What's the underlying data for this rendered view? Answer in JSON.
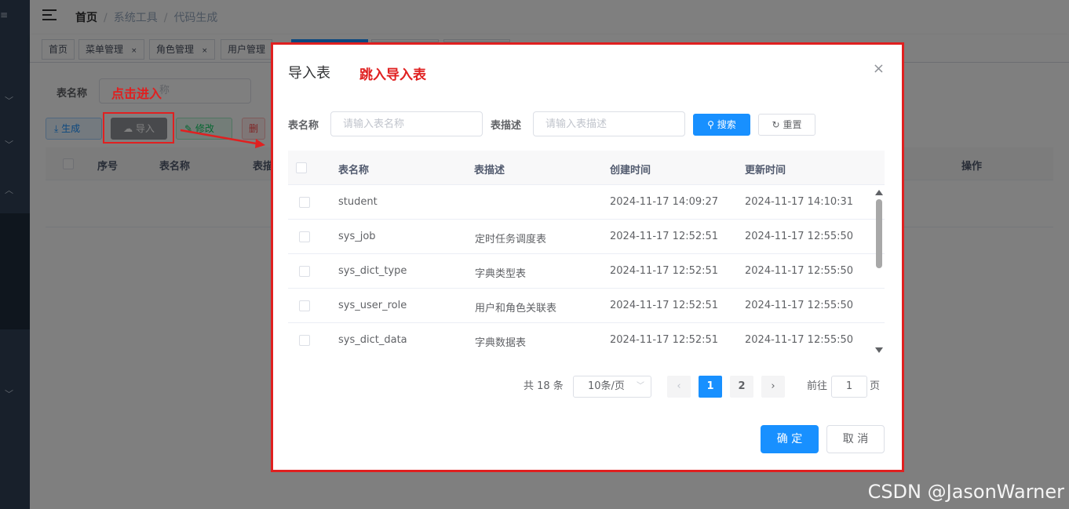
{
  "sidebar": {
    "top_glyph": "≡"
  },
  "navbar": {
    "breadcrumb": [
      "首页",
      "系统工具",
      "代码生成"
    ]
  },
  "tags": [
    {
      "label": "首页"
    },
    {
      "label": "菜单管理",
      "close": "×"
    },
    {
      "label": "角色管理",
      "close": "×"
    },
    {
      "label": "用户管理"
    }
  ],
  "background": {
    "filter_label": "表名称",
    "filter_placeholder": "称",
    "buttons": {
      "generate": "生成",
      "import": "导入",
      "edit": "修改",
      "delete": "删"
    },
    "columns": [
      "序号",
      "表名称",
      "表描",
      "操作"
    ],
    "colors": {
      "primary": "#1890ff",
      "sidebar": "#304156"
    }
  },
  "annotations": {
    "click_text": "点击进入",
    "dialog_text": "跳入导入表",
    "color": "#e02020"
  },
  "dialog": {
    "title": "导入表",
    "close": "×",
    "search": {
      "name_label": "表名称",
      "name_placeholder": "请输入表名称",
      "desc_label": "表描述",
      "desc_placeholder": "请输入表描述",
      "search_button": "搜索",
      "reset_button": "重置",
      "search_icon": "⚲",
      "reset_icon": "↻"
    },
    "table": {
      "columns": [
        "表名称",
        "表描述",
        "创建时间",
        "更新时间"
      ],
      "rows": [
        {
          "name": "student",
          "desc": "",
          "created": "2024-11-17 14:09:27",
          "updated": "2024-11-17 14:10:31"
        },
        {
          "name": "sys_job",
          "desc": "定时任务调度表",
          "created": "2024-11-17 12:52:51",
          "updated": "2024-11-17 12:55:50"
        },
        {
          "name": "sys_dict_type",
          "desc": "字典类型表",
          "created": "2024-11-17 12:52:51",
          "updated": "2024-11-17 12:55:50"
        },
        {
          "name": "sys_user_role",
          "desc": "用户和角色关联表",
          "created": "2024-11-17 12:52:51",
          "updated": "2024-11-17 12:55:50"
        },
        {
          "name": "sys_dict_data",
          "desc": "字典数据表",
          "created": "2024-11-17 12:52:51",
          "updated": "2024-11-17 12:55:50"
        }
      ]
    },
    "pagination": {
      "total": "共 18 条",
      "page_size": "10条/页",
      "pages": [
        "1",
        "2"
      ],
      "current_page": 1,
      "prev": "‹",
      "next": "›",
      "goto_label": "前往",
      "goto_value": "1",
      "page_suffix": "页"
    },
    "footer": {
      "confirm": "确 定",
      "cancel": "取 消"
    }
  },
  "watermark": "CSDN @JasonWarner"
}
